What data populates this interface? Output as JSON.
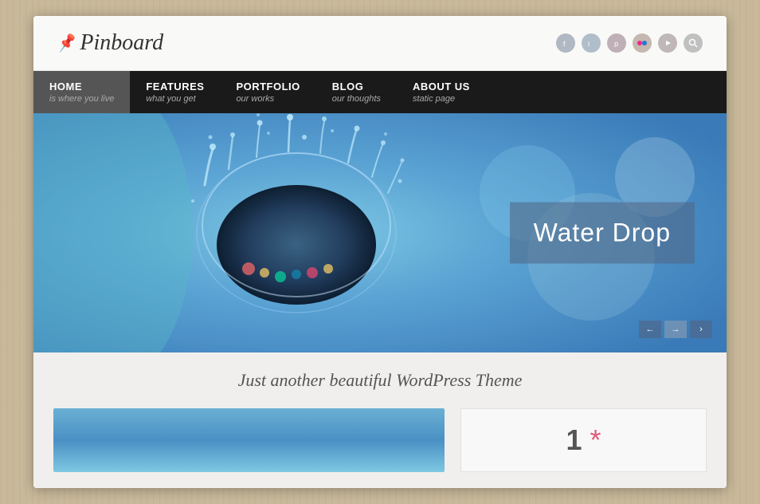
{
  "site": {
    "logo": "Pinboard",
    "tagline": "Just another beautiful WordPress Theme"
  },
  "header": {
    "social_icons": [
      {
        "name": "facebook",
        "symbol": "f"
      },
      {
        "name": "twitter",
        "symbol": "t"
      },
      {
        "name": "pinterest",
        "symbol": "p"
      },
      {
        "name": "flickr",
        "symbol": "fl"
      },
      {
        "name": "youtube",
        "symbol": "▶"
      },
      {
        "name": "search",
        "symbol": "🔍"
      }
    ]
  },
  "nav": {
    "items": [
      {
        "label": "HOME",
        "sub": "is where you live",
        "active": true
      },
      {
        "label": "FEATURES",
        "sub": "what you get",
        "active": false
      },
      {
        "label": "PORTFOLIO",
        "sub": "our works",
        "active": false
      },
      {
        "label": "BLOG",
        "sub": "our thoughts",
        "active": false
      },
      {
        "label": "ABOUT US",
        "sub": "static page",
        "active": false
      }
    ]
  },
  "hero": {
    "title": "Water Drop",
    "slide_prev": "←",
    "slide_next": "→",
    "slide_indicator": "›"
  },
  "content": {
    "number": "1",
    "asterisk": "*"
  }
}
